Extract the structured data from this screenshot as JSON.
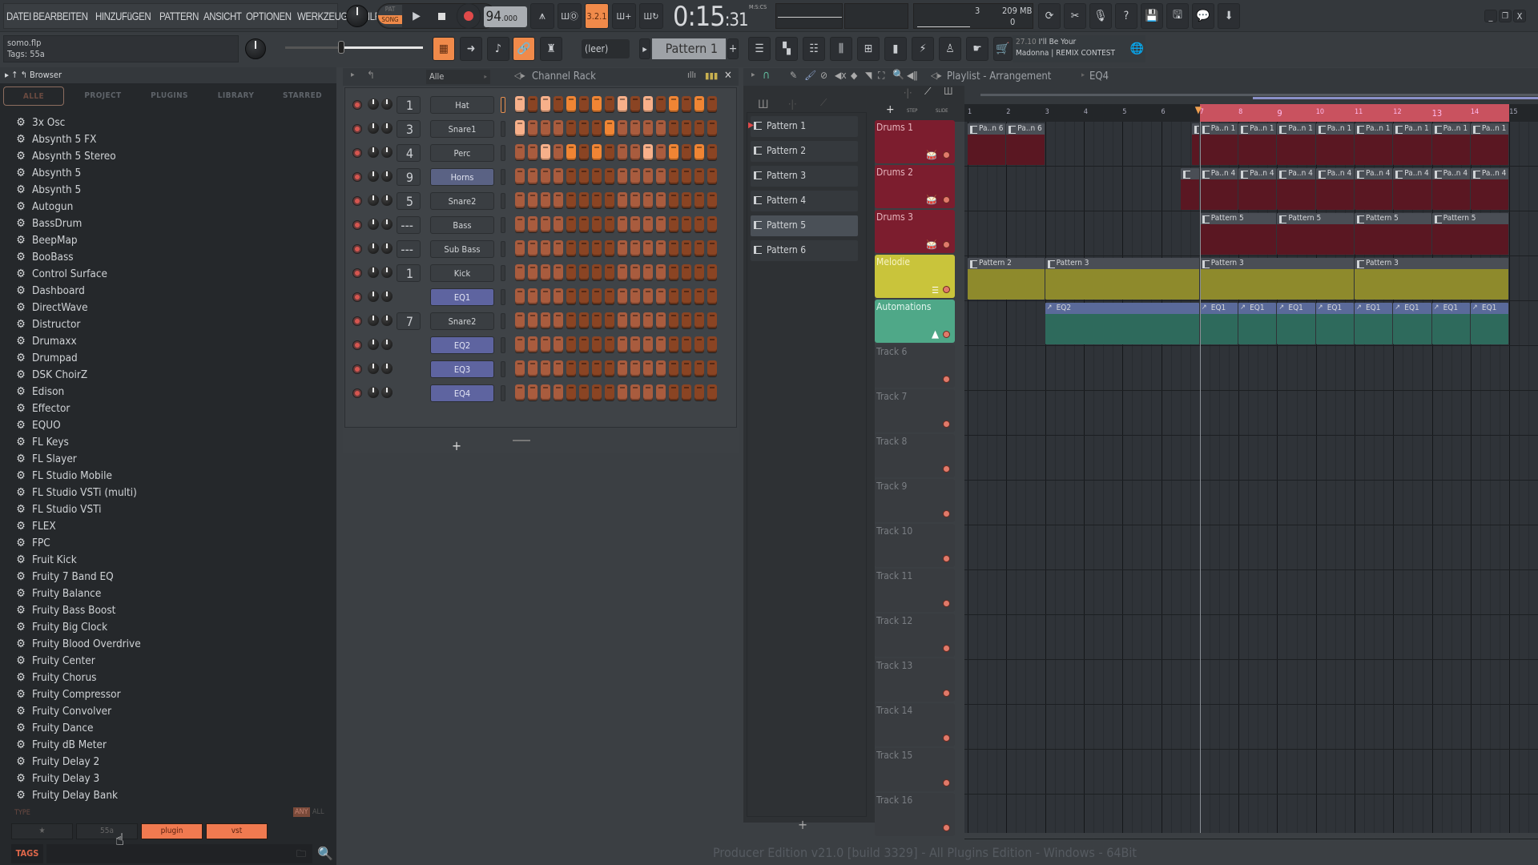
{
  "menu": [
    "DATEI",
    "BEARBEITEN",
    "HINZUFüGEN",
    "PATTERN",
    "ANSICHT",
    "OPTIONEN",
    "WERKZEUGE",
    "HILFE"
  ],
  "transport": {
    "pat_label": "PAT",
    "song_label": "SONG",
    "mode": "SONG",
    "tempo": "94",
    "tempo_decimal": ".000",
    "time_main": "0:15",
    "time_cs": ":31",
    "time_format": "M:S:CS",
    "snap_label": "3.2.1",
    "cpu_value": "3",
    "memory": "209 MB",
    "polyphony": "0"
  },
  "hint": {
    "file": "somo.flp",
    "tags": "Tags: 55a"
  },
  "toolbar2": {
    "pattern_selector": "(leer)",
    "pattern_name": "Pattern 1"
  },
  "news": {
    "date": "27.10",
    "line1": "I'll Be Your",
    "line2": "Madonna | REMIX CONTEST"
  },
  "window": {
    "minimize": "_",
    "maximize": "❐",
    "close": "X"
  },
  "browser": {
    "title": "Browser",
    "tabs": [
      "ALLE",
      "PROJECT",
      "PLUGINS",
      "LIBRARY",
      "STARRED"
    ],
    "active_tab": "ALLE",
    "items": [
      "3x Osc",
      "Absynth 5 FX",
      "Absynth 5 Stereo",
      "Absynth 5",
      "Absynth 5",
      "Autogun",
      "BassDrum",
      "BeepMap",
      "BooBass",
      "Control Surface",
      "Dashboard",
      "DirectWave",
      "Distructor",
      "Drumaxx",
      "Drumpad",
      "DSK ChoirZ",
      "Edison",
      "Effector",
      "EQUO",
      "FL Keys",
      "FL Slayer",
      "FL Studio Mobile",
      "FL Studio VSTi (multi)",
      "FL Studio VSTi",
      "FLEX",
      "FPC",
      "Fruit Kick",
      "Fruity 7 Band EQ",
      "Fruity Balance",
      "Fruity Bass Boost",
      "Fruity Big Clock",
      "Fruity Blood Overdrive",
      "Fruity Center",
      "Fruity Chorus",
      "Fruity Compressor",
      "Fruity Convolver",
      "Fruity Dance",
      "Fruity dB Meter",
      "Fruity Delay 2",
      "Fruity Delay 3",
      "Fruity Delay Bank"
    ],
    "type_label": "TYPE",
    "any_label": "ANY",
    "all_label": "ALL",
    "tag_buttons": [
      "★",
      "55a",
      "plugin",
      "vst"
    ],
    "tags_label": "TAGS"
  },
  "channel_rack": {
    "title": "Channel Rack",
    "filter": "Alle",
    "add_label": "+",
    "channels": [
      {
        "num": "1",
        "name": "Hat",
        "type": "normal",
        "steps": "LdLdHdHdLdLdHdHd"
      },
      {
        "num": "3",
        "name": "Snare1",
        "type": "normal",
        "steps": "LnnndddHnnnndddd"
      },
      {
        "num": "4",
        "name": "Perc",
        "type": "normal",
        "steps": "nnLnHdHdnnLnHdHd"
      },
      {
        "num": "9",
        "name": "Horns",
        "type": "selected",
        "steps": "nnnnddddnnnndddd"
      },
      {
        "num": "5",
        "name": "Snare2",
        "type": "normal",
        "steps": "nnnnddddnnnndddd"
      },
      {
        "num": "---",
        "name": "Bass",
        "type": "normal",
        "steps": "nnnnddddnnnndddd"
      },
      {
        "num": "---",
        "name": "Sub Bass",
        "type": "normal",
        "steps": "nnnnddddnnnndddd"
      },
      {
        "num": "1",
        "name": "Kick",
        "type": "normal",
        "steps": "nnnnddddnnnndddd"
      },
      {
        "num": "",
        "name": "EQ1",
        "type": "auto",
        "steps": "nnnnddddnnnndddd"
      },
      {
        "num": "7",
        "name": "Snare2",
        "type": "normal",
        "steps": "nnnnddddnnnndddd"
      },
      {
        "num": "",
        "name": "EQ2",
        "type": "auto",
        "steps": "nnnnddddnnnndddd"
      },
      {
        "num": "",
        "name": "EQ3",
        "type": "auto",
        "steps": "nnnnddddnnnndddd"
      },
      {
        "num": "",
        "name": "EQ4",
        "type": "auto",
        "steps": "nnnnddddnnnndddd"
      }
    ]
  },
  "playlist": {
    "title": "Playlist - Arrangement",
    "breadcrumb": "EQ4",
    "step_label": "STEP",
    "slide_label": "SLIDE",
    "add_label": "+",
    "patterns": [
      "Pattern 1",
      "Pattern 2",
      "Pattern 3",
      "Pattern 4",
      "Pattern 5",
      "Pattern 6"
    ],
    "selected_pattern": "Pattern 5",
    "ruler": [
      "1",
      "2",
      "3",
      "4",
      "5",
      "6",
      "7",
      "8",
      "9",
      "10",
      "11",
      "12",
      "13",
      "14",
      "15"
    ],
    "tracks": [
      {
        "name": "Drums 1",
        "kind": "drums"
      },
      {
        "name": "Drums 2",
        "kind": "drums"
      },
      {
        "name": "Drums 3",
        "kind": "drums"
      },
      {
        "name": "Melodie",
        "kind": "melody"
      },
      {
        "name": "Automations",
        "kind": "auto"
      },
      {
        "name": "Track 6",
        "kind": "empty"
      },
      {
        "name": "Track 7",
        "kind": "empty"
      },
      {
        "name": "Track 8",
        "kind": "empty"
      },
      {
        "name": "Track 9",
        "kind": "empty"
      },
      {
        "name": "Track 10",
        "kind": "empty"
      },
      {
        "name": "Track 11",
        "kind": "empty"
      },
      {
        "name": "Track 12",
        "kind": "empty"
      },
      {
        "name": "Track 13",
        "kind": "empty"
      },
      {
        "name": "Track 14",
        "kind": "empty"
      },
      {
        "name": "Track 15",
        "kind": "empty"
      },
      {
        "name": "Track 16",
        "kind": "empty"
      }
    ],
    "clips": [
      {
        "track": 0,
        "start": 1,
        "len": 1,
        "label": "Pa..n 6",
        "kind": "drum"
      },
      {
        "track": 0,
        "start": 2,
        "len": 1,
        "label": "Pa..n 6",
        "kind": "drum"
      },
      {
        "track": 0,
        "start": 6.8,
        "len": 0.2,
        "label": "",
        "kind": "drum"
      },
      {
        "track": 0,
        "start": 7,
        "len": 1,
        "label": "Pa..n 1",
        "kind": "drum"
      },
      {
        "track": 0,
        "start": 8,
        "len": 1,
        "label": "Pa..n 1",
        "kind": "drum"
      },
      {
        "track": 0,
        "start": 9,
        "len": 1,
        "label": "Pa..n 1",
        "kind": "drum"
      },
      {
        "track": 0,
        "start": 10,
        "len": 1,
        "label": "Pa..n 1",
        "kind": "drum"
      },
      {
        "track": 0,
        "start": 11,
        "len": 1,
        "label": "Pa..n 1",
        "kind": "drum"
      },
      {
        "track": 0,
        "start": 12,
        "len": 1,
        "label": "Pa..n 1",
        "kind": "drum"
      },
      {
        "track": 0,
        "start": 13,
        "len": 1,
        "label": "Pa..n 1",
        "kind": "drum"
      },
      {
        "track": 0,
        "start": 14,
        "len": 1,
        "label": "Pa..n 1",
        "kind": "drum"
      },
      {
        "track": 1,
        "start": 6.5,
        "len": 0.5,
        "label": "",
        "kind": "drum"
      },
      {
        "track": 1,
        "start": 7,
        "len": 1,
        "label": "Pa..n 4",
        "kind": "drum"
      },
      {
        "track": 1,
        "start": 8,
        "len": 1,
        "label": "Pa..n 4",
        "kind": "drum"
      },
      {
        "track": 1,
        "start": 9,
        "len": 1,
        "label": "Pa..n 4",
        "kind": "drum"
      },
      {
        "track": 1,
        "start": 10,
        "len": 1,
        "label": "Pa..n 4",
        "kind": "drum"
      },
      {
        "track": 1,
        "start": 11,
        "len": 1,
        "label": "Pa..n 4",
        "kind": "drum"
      },
      {
        "track": 1,
        "start": 12,
        "len": 1,
        "label": "Pa..n 4",
        "kind": "drum"
      },
      {
        "track": 1,
        "start": 13,
        "len": 1,
        "label": "Pa..n 4",
        "kind": "drum"
      },
      {
        "track": 1,
        "start": 14,
        "len": 1,
        "label": "Pa..n 4",
        "kind": "drum"
      },
      {
        "track": 2,
        "start": 7,
        "len": 2,
        "label": "Pattern 5",
        "kind": "drum"
      },
      {
        "track": 2,
        "start": 9,
        "len": 2,
        "label": "Pattern 5",
        "kind": "drum"
      },
      {
        "track": 2,
        "start": 11,
        "len": 2,
        "label": "Pattern 5",
        "kind": "drum"
      },
      {
        "track": 2,
        "start": 13,
        "len": 2,
        "label": "Pattern 5",
        "kind": "drum"
      },
      {
        "track": 3,
        "start": 1,
        "len": 2,
        "label": "Pattern 2",
        "kind": "melody"
      },
      {
        "track": 3,
        "start": 3,
        "len": 4,
        "label": "Pattern 3",
        "kind": "melody"
      },
      {
        "track": 3,
        "start": 7,
        "len": 4,
        "label": "Pattern 3",
        "kind": "melody"
      },
      {
        "track": 3,
        "start": 11,
        "len": 4,
        "label": "Pattern 3",
        "kind": "melody"
      },
      {
        "track": 4,
        "start": 3,
        "len": 4,
        "label": "EQ2",
        "kind": "auto"
      },
      {
        "track": 4,
        "start": 7,
        "len": 1,
        "label": "EQ1",
        "kind": "auto"
      },
      {
        "track": 4,
        "start": 8,
        "len": 1,
        "label": "EQ1",
        "kind": "auto"
      },
      {
        "track": 4,
        "start": 9,
        "len": 1,
        "label": "EQ1",
        "kind": "auto"
      },
      {
        "track": 4,
        "start": 10,
        "len": 1,
        "label": "EQ1",
        "kind": "auto"
      },
      {
        "track": 4,
        "start": 11,
        "len": 1,
        "label": "EQ1",
        "kind": "auto"
      },
      {
        "track": 4,
        "start": 12,
        "len": 1,
        "label": "EQ1",
        "kind": "auto"
      },
      {
        "track": 4,
        "start": 13,
        "len": 1,
        "label": "EQ1",
        "kind": "auto"
      },
      {
        "track": 4,
        "start": 14,
        "len": 1,
        "label": "EQ1",
        "kind": "auto"
      }
    ],
    "playhead_bar": 7,
    "loop_start_bar": 7,
    "loop_end_bar": 15
  },
  "status": {
    "version": "Producer Edition v21.0 [build 3329] - All Plugins Edition - Windows - 64Bit"
  }
}
